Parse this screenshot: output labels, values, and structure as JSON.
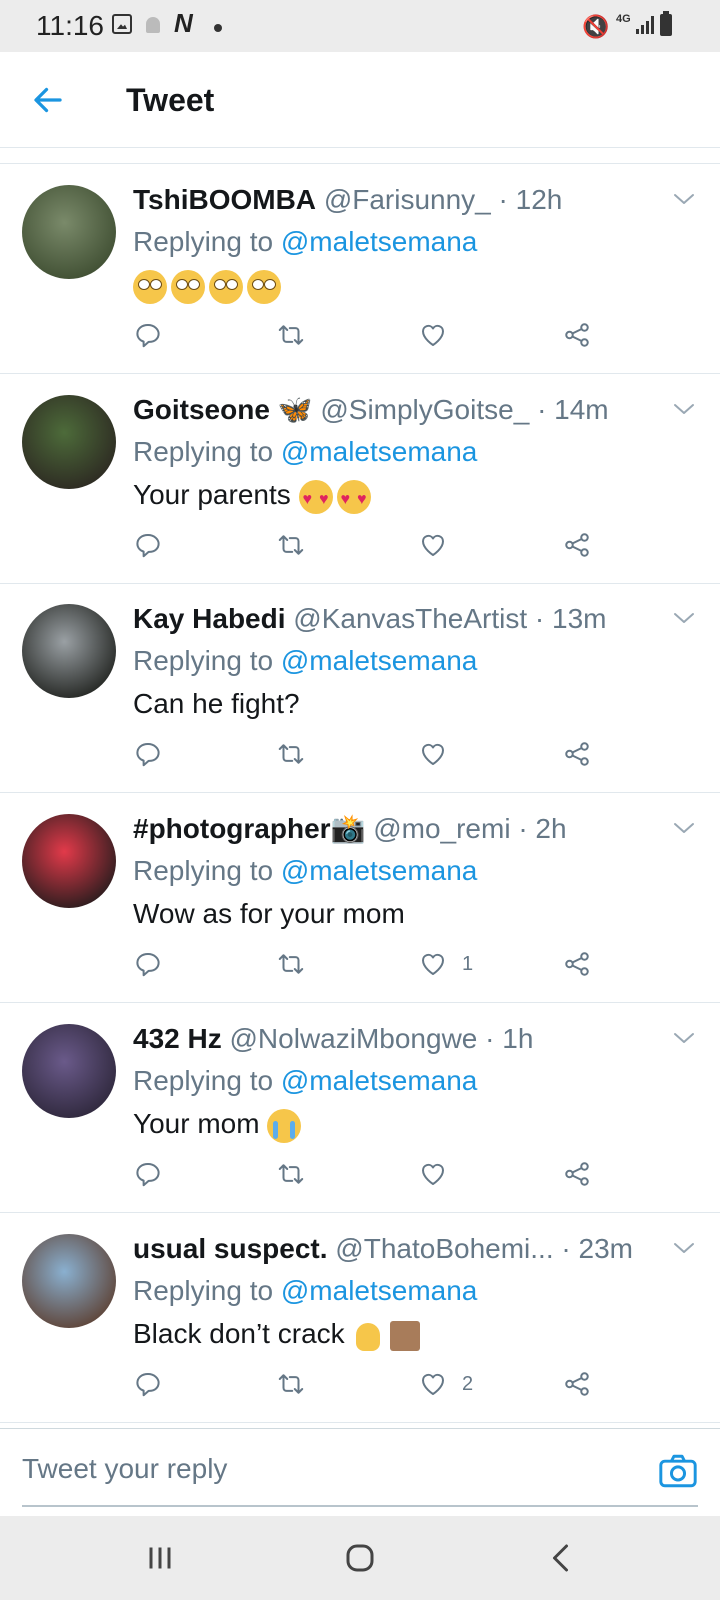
{
  "status_bar": {
    "time": "11:16",
    "network": "4G"
  },
  "header": {
    "title": "Tweet"
  },
  "tweets": [
    {
      "display_name": "TshiBOOMBA",
      "handle": "@Farisunny_",
      "time": "· 12h",
      "replying_label": "Replying to",
      "replying_to": "@maletsemana",
      "text": "",
      "emojis": [
        "face-with-rolling-eyes",
        "face-with-rolling-eyes",
        "face-with-rolling-eyes",
        "face-with-rolling-eyes"
      ],
      "like_count": "",
      "avatar_colors": [
        "#7a8a6a",
        "#3b4a2e"
      ]
    },
    {
      "display_name": "Goitseone 🦋",
      "handle": "@SimplyGoitse_",
      "time": "· 14m",
      "replying_label": "Replying to",
      "replying_to": "@maletsemana",
      "text": "Your parents",
      "emojis": [
        "smiling-face-with-heart-eyes",
        "smiling-face-with-heart-eyes"
      ],
      "like_count": "",
      "avatar_colors": [
        "#4d6b3a",
        "#2a2420"
      ]
    },
    {
      "display_name": "Kay Habedi",
      "handle": "@KanvasTheArtist",
      "time": "· 13m",
      "replying_label": "Replying to",
      "replying_to": "@maletsemana",
      "text": "Can he fight?",
      "emojis": [],
      "like_count": "",
      "avatar_colors": [
        "#9aa0a4",
        "#1a1c18"
      ]
    },
    {
      "display_name": "#photographer📸",
      "handle": "@mo_remi",
      "time": "· 2h",
      "replying_label": "Replying to",
      "replying_to": "@maletsemana",
      "text": "Wow as for your mom",
      "emojis": [],
      "like_count": "1",
      "avatar_colors": [
        "#e23a4a",
        "#1a1a1a"
      ]
    },
    {
      "display_name": "432 Hz",
      "handle": "@NolwaziMbongwe",
      "time": "· 1h",
      "replying_label": "Replying to",
      "replying_to": "@maletsemana",
      "text": "Your mom",
      "emojis": [
        "loudly-crying-face"
      ],
      "like_count": "",
      "avatar_colors": [
        "#6a5a8a",
        "#2a2436"
      ]
    },
    {
      "display_name": "usual suspect.",
      "handle": "@ThatoBohemi...",
      "time": "· 23m",
      "replying_label": "Replying to",
      "replying_to": "@maletsemana",
      "text": "Black don’t crack",
      "emojis": [
        "pinching-hand",
        "medium-skin-tone"
      ],
      "like_count": "2",
      "avatar_colors": [
        "#8ab0d0",
        "#5a3a2a"
      ]
    }
  ],
  "reply_bar": {
    "placeholder": "Tweet your reply"
  },
  "colors": {
    "accent": "#1b95e0",
    "secondary_text": "#657786",
    "divider": "#e1e8ed"
  },
  "icons": {
    "back": "arrow-left-icon",
    "caret": "chevron-down-icon",
    "reply": "reply-icon",
    "retweet": "retweet-icon",
    "like": "heart-icon",
    "share": "share-icon",
    "camera": "camera-icon"
  }
}
